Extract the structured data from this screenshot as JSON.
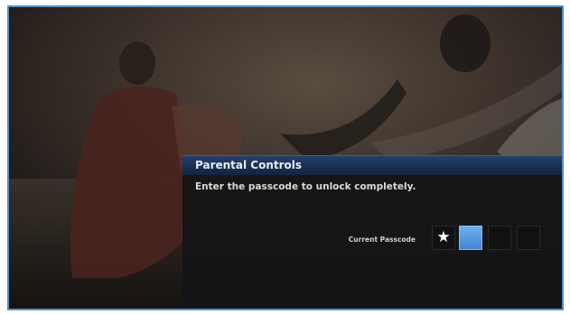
{
  "dialog": {
    "title": "Parental Controls",
    "instruction": "Enter the passcode to unlock completely.",
    "passcode_label": "Current Passcode",
    "digits": [
      {
        "value": "★",
        "state": "entered"
      },
      {
        "value": "",
        "state": "active"
      },
      {
        "value": "",
        "state": "empty"
      },
      {
        "value": "",
        "state": "empty"
      }
    ]
  },
  "colors": {
    "accent": "#4a90dd",
    "header": "#1d3559",
    "panel": "#141416",
    "frame": "#4f8fc7"
  }
}
